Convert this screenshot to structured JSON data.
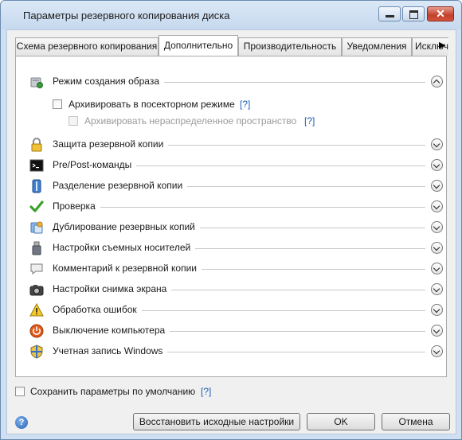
{
  "window": {
    "title": "Параметры резервного копирования диска"
  },
  "tabs": [
    {
      "label": "Схема резервного копирования"
    },
    {
      "label": "Дополнительно"
    },
    {
      "label": "Производительность"
    },
    {
      "label": "Уведомления"
    },
    {
      "label": "Исключ"
    }
  ],
  "sections": {
    "image_mode": {
      "label": "Режим создания образа",
      "expanded": true,
      "options": {
        "sector_by_sector": {
          "label": "Архивировать в посекторном режиме",
          "help": "[?]",
          "checked": false
        },
        "unallocated": {
          "label": "Архивировать нераспределенное пространство",
          "help": "[?]",
          "checked": false,
          "enabled": false
        }
      }
    },
    "protection": {
      "label": "Защита резервной копии"
    },
    "prepost": {
      "label": "Pre/Post-команды"
    },
    "splitting": {
      "label": "Разделение резервной копии"
    },
    "validation": {
      "label": "Проверка"
    },
    "duplication": {
      "label": "Дублирование резервных копий"
    },
    "removable": {
      "label": "Настройки съемных носителей"
    },
    "comment": {
      "label": "Комментарий к резервной копии"
    },
    "screenshot": {
      "label": "Настройки снимка экрана"
    },
    "errors": {
      "label": "Обработка ошибок"
    },
    "shutdown": {
      "label": "Выключение компьютера"
    },
    "windows_account": {
      "label": "Учетная запись Windows"
    }
  },
  "footer": {
    "save_default": {
      "label": "Сохранить параметры по умолчанию",
      "help": "[?]",
      "checked": false
    },
    "help_glyph": "?",
    "buttons": {
      "restore": "Восстановить исходные настройки",
      "ok": "OK",
      "cancel": "Отмена"
    }
  },
  "colors": {
    "accent": "#1f5fb8",
    "titlebar": "#cfe0f2",
    "close": "#c2412b"
  }
}
